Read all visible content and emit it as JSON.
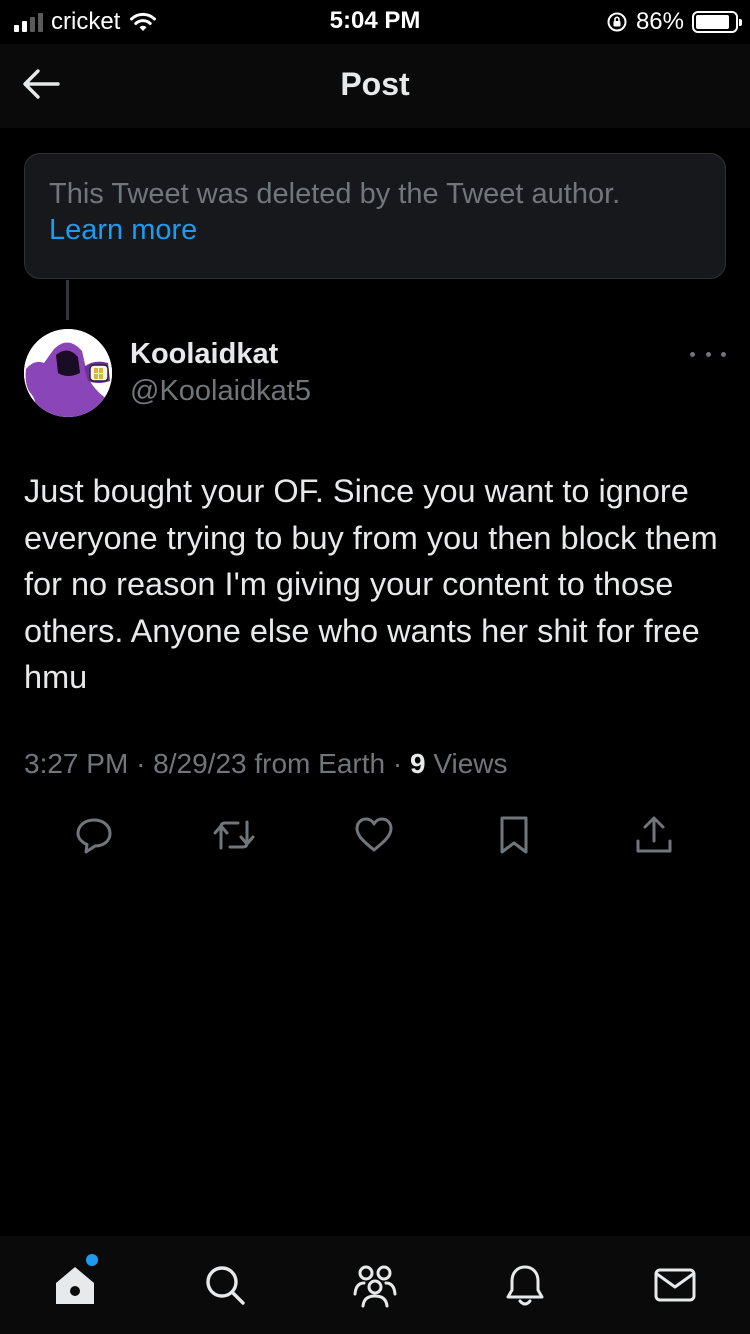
{
  "status_bar": {
    "carrier": "cricket",
    "time": "5:04 PM",
    "battery_percent": "86%",
    "battery_level": 0.86,
    "signal_bars_active": 2,
    "signal_bars_total": 4
  },
  "header": {
    "title": "Post",
    "back_icon": "arrow-left-icon"
  },
  "deleted_notice": {
    "text": "This Tweet was deleted by the Tweet author.",
    "link": "Learn more"
  },
  "tweet": {
    "author_name": "Koolaidkat",
    "author_handle": "@Koolaidkat5",
    "text": "Just bought your OF. Since you want to ignore everyone trying to buy from you then block them for no reason I'm giving your content to those others. Anyone else who wants her shit for free hmu",
    "time": "3:27 PM",
    "sep1": "·",
    "date": "8/29/23",
    "source": "from Earth",
    "sep2": "·",
    "views_count": "9",
    "views_label": "Views"
  },
  "actions": [
    "reply-icon",
    "retweet-icon",
    "like-icon",
    "bookmark-icon",
    "share-icon"
  ],
  "bottom_nav": [
    "home-icon",
    "search-icon",
    "communities-icon",
    "notifications-icon",
    "messages-icon"
  ],
  "colors": {
    "background": "#000000",
    "text_primary": "#e7e9ea",
    "text_secondary": "#71767b",
    "accent": "#1d9bf0",
    "card_bg": "#16181c",
    "border": "#2f3336"
  }
}
